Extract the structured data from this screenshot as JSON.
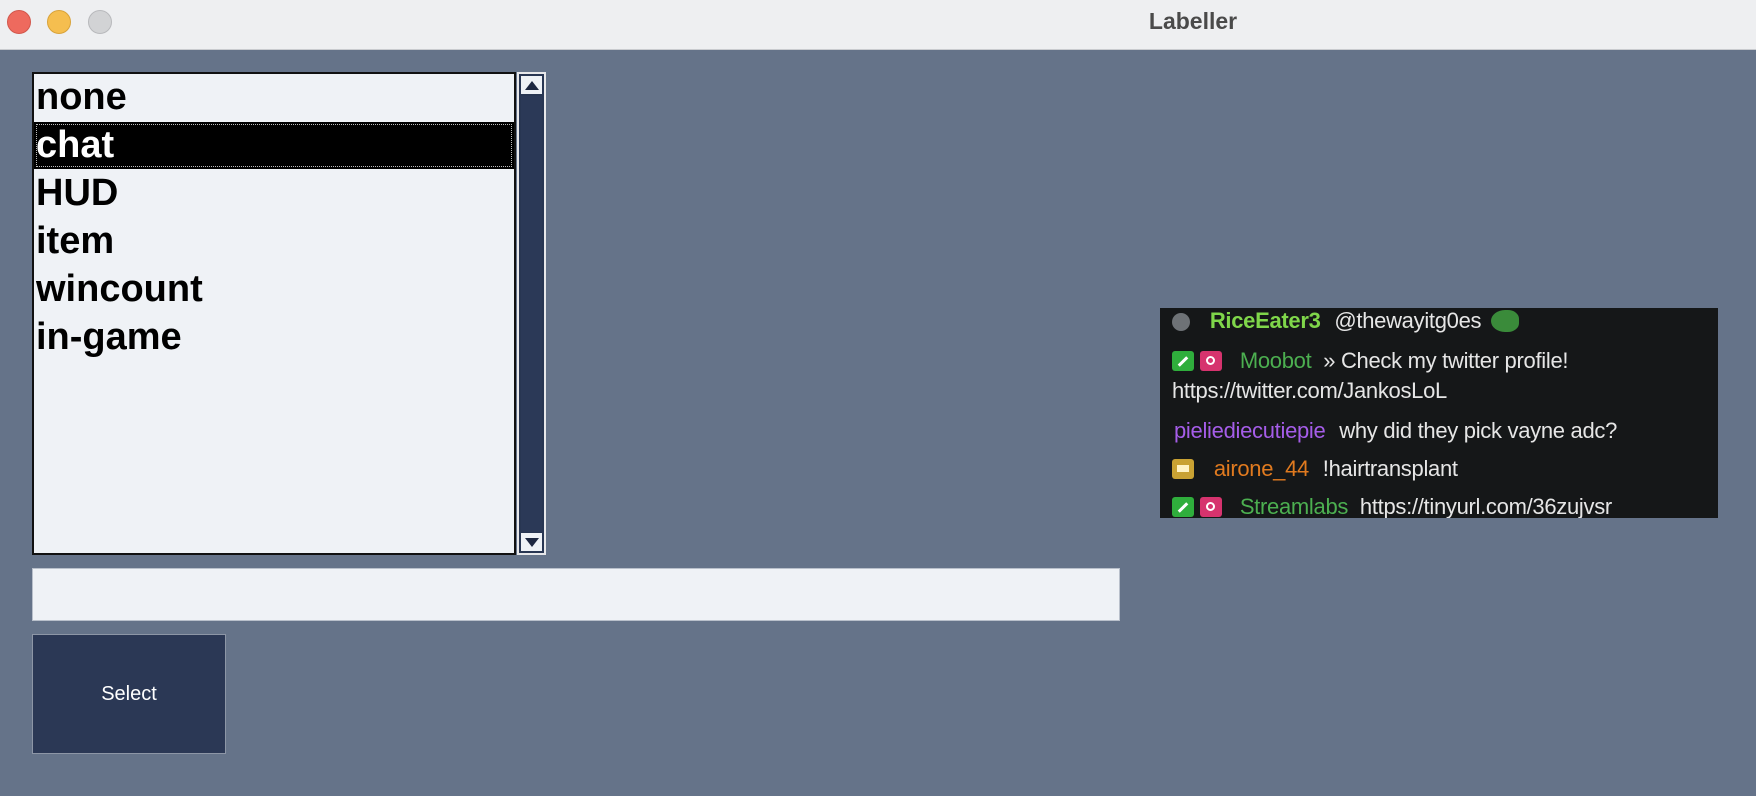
{
  "window": {
    "title": "Labeller"
  },
  "listbox": {
    "items": [
      "none",
      "chat",
      "HUD",
      "item",
      "wincount",
      "in-game"
    ],
    "selected_index": 1
  },
  "text_input": {
    "value": ""
  },
  "select_button": {
    "label": "Select"
  },
  "chat_preview": {
    "lines": [
      {
        "user": "RiceEater3",
        "message": "@thewayitg0es"
      },
      {
        "user": "Moobot",
        "message": "» Check my twitter profile!"
      },
      {
        "user": "",
        "message": "https://twitter.com/JankosLoL"
      },
      {
        "user": "pieliediecutiepie",
        "message": "why did they pick vayne adc?"
      },
      {
        "user": "airone_44",
        "message": "!hairtransplant"
      },
      {
        "user": "Streamlabs",
        "message": "https://tinyurl.com/36zujvsr"
      }
    ]
  },
  "colors": {
    "background": "#657389",
    "button": "#2b3855",
    "selection": "#000000"
  }
}
